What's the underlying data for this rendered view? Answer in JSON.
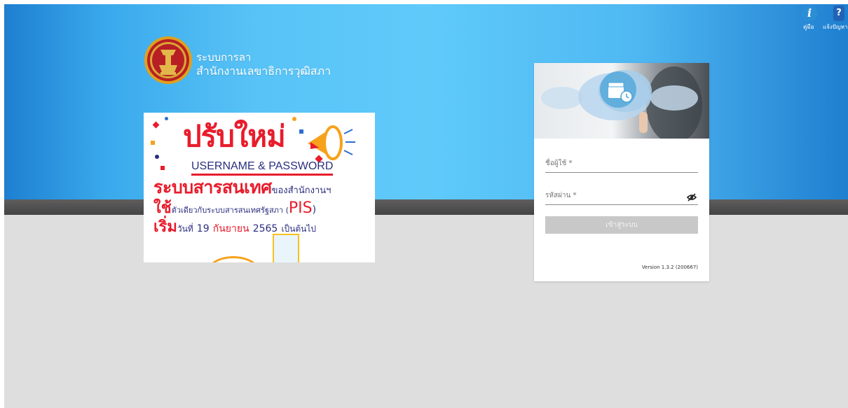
{
  "brand": {
    "line1": "ระบบการลา",
    "line2": "สำนักงานเลขาธิการวุฒิสภา"
  },
  "banner": {
    "headline": "ปรับใหม่",
    "userpass": "USERNAME & PASSWORD",
    "system_big": "ระบบสารสนเทศ",
    "system_small": "ของสำนักงานฯ",
    "use_big": "ใช้",
    "use_small": "ตัวเดียวกับระบบสารสนเทศรัฐสภา (",
    "use_pis": "PIS",
    "use_close": ")",
    "start_big": "เริ่ม",
    "start_small": "วันที่",
    "start_day": "19",
    "start_month": "กันยายน",
    "start_year": "2565",
    "start_tail": "เป็นต้นไป"
  },
  "login": {
    "username_label": "ชื่อผู้ใช้ *",
    "password_label": "รหัสผ่าน *",
    "submit_label": "เข้าสู่ระบบ",
    "version": "Version 1.3.2 (200667)"
  },
  "topbar": {
    "manual_label": "คู่มือ",
    "report_label": "แจ้งปัญหา",
    "manual_icon": "i",
    "report_icon": "?"
  },
  "colors": {
    "hero_blue": "#5fcafa",
    "banner_red": "#e81c2c",
    "banner_navy": "#2b2e7f",
    "button_gray": "#c8c8c8"
  }
}
